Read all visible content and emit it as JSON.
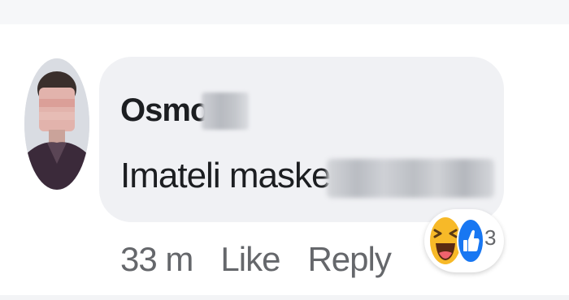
{
  "comment": {
    "author_visible": "Osmo M",
    "text_visible": "Imateli maske za",
    "timestamp": "33 m",
    "actions": {
      "like_label": "Like",
      "reply_label": "Reply"
    },
    "reactions": {
      "types": [
        "haha-icon",
        "like-icon"
      ],
      "count": "3"
    }
  },
  "colors": {
    "bubble": "#f0f1f4",
    "text": "#1c1e21",
    "secondary_text": "#65676b",
    "like_blue": "#1877f2",
    "haha_yellow": "#f7b928"
  }
}
